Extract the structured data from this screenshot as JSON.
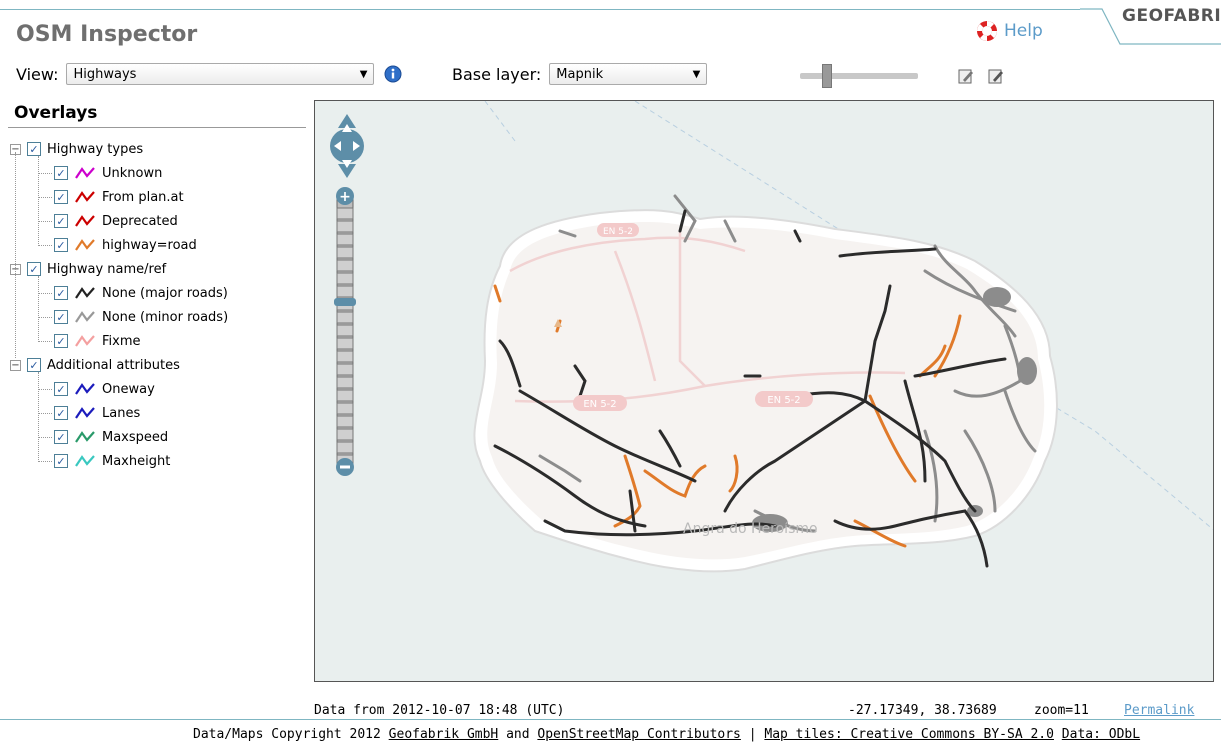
{
  "header": {
    "app_title": "OSM Inspector",
    "help_label": "Help",
    "brand_tab": "GEOFABRIK"
  },
  "toolbar": {
    "view_label": "View:",
    "view_value": "Highways",
    "base_layer_label": "Base layer:",
    "base_layer_value": "Mapnik"
  },
  "overlays": {
    "title": "Overlays",
    "groups": [
      {
        "label": "Highway types",
        "items": [
          {
            "label": "Unknown",
            "color": "#cc00cc"
          },
          {
            "label": "From plan.at",
            "color": "#cc0000"
          },
          {
            "label": "Deprecated",
            "color": "#cc0000"
          },
          {
            "label": "highway=road",
            "color": "#e07a2a"
          }
        ]
      },
      {
        "label": "Highway name/ref",
        "items": [
          {
            "label": "None (major roads)",
            "color": "#222222"
          },
          {
            "label": "None (minor roads)",
            "color": "#999999"
          },
          {
            "label": "Fixme",
            "color": "#f4a0a0"
          }
        ]
      },
      {
        "label": "Additional attributes",
        "items": [
          {
            "label": "Oneway",
            "color": "#1c1cbc"
          },
          {
            "label": "Lanes",
            "color": "#1c1cbc"
          },
          {
            "label": "Maxspeed",
            "color": "#2a9a6a"
          },
          {
            "label": "Maxheight",
            "color": "#3ac8c0"
          }
        ]
      }
    ]
  },
  "map": {
    "road_labels": [
      "EN 5-2",
      "EN 5-2",
      "EN 5-2"
    ],
    "town_label": "Angra do Heroísmo",
    "colors": {
      "water": "#e9efee",
      "land": "#f6f3f1",
      "major": "#2b2b2b",
      "minor": "#8c8c8c",
      "road": "#e07a2a"
    }
  },
  "status": {
    "data_date": "Data from 2012-10-07 18:48 (UTC)",
    "coords": "-27.17349, 38.73689",
    "zoom": "zoom=11",
    "permalink": "Permalink"
  },
  "footer": {
    "prefix": "Data/Maps Copyright 2012 ",
    "geofabrik_link": "Geofabrik GmbH",
    "and": " and ",
    "osm_link": "OpenStreetMap Contributors",
    "sep": " | ",
    "tiles_link": "Map tiles: Creative Commons BY-SA 2.0",
    "space": " ",
    "data_link": "Data: ODbL"
  }
}
